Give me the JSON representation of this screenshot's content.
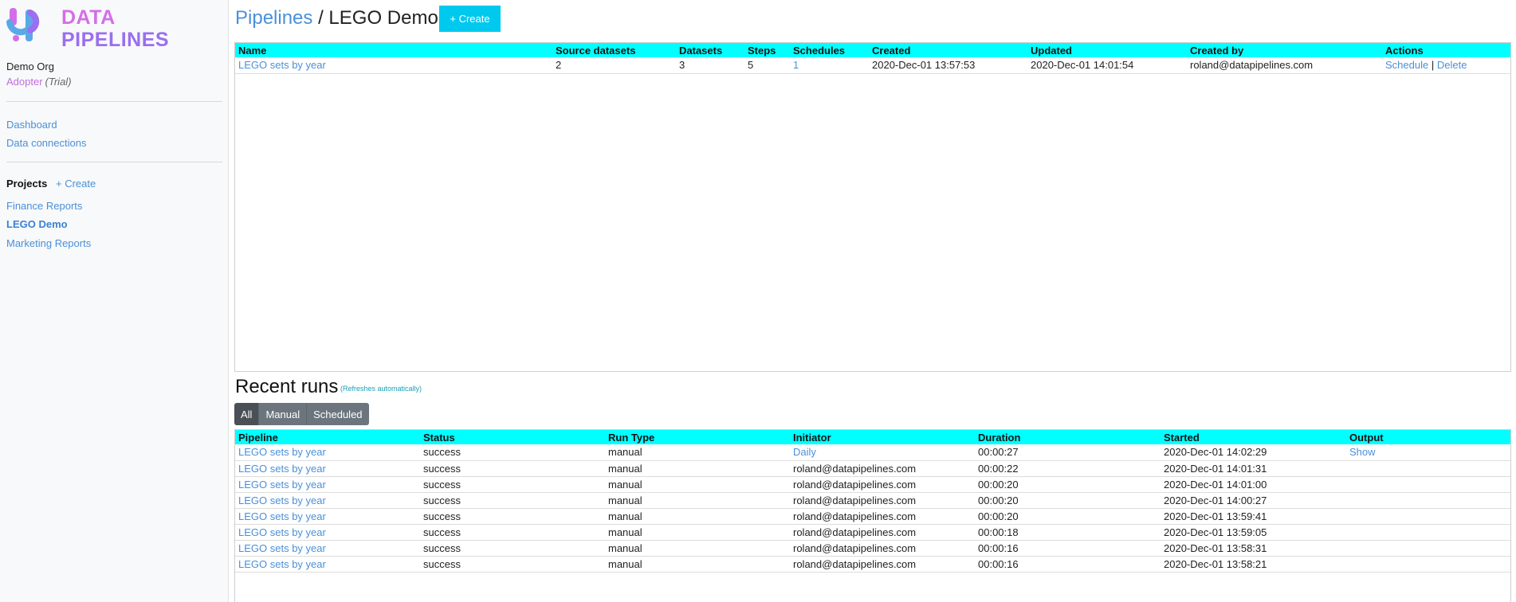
{
  "app": {
    "logo_line1": "DATA",
    "logo_line2": "PIPELINES",
    "org_name": "Demo Org",
    "plan_tier": "Adopter",
    "plan_trial": "(Trial)"
  },
  "sidebar": {
    "nav": [
      {
        "label": "Dashboard"
      },
      {
        "label": "Data connections"
      }
    ],
    "projects_heading": "Projects",
    "projects_create": "+ Create",
    "projects": [
      {
        "label": "Finance Reports",
        "active": false
      },
      {
        "label": "LEGO Demo",
        "active": true
      },
      {
        "label": "Marketing Reports",
        "active": false
      }
    ]
  },
  "header": {
    "crumb": "Pipelines",
    "separator": " / ",
    "title": "LEGO Demo",
    "create_label": "+ Create"
  },
  "pipelines_table": {
    "columns": [
      "Name",
      "Source datasets",
      "Datasets",
      "Steps",
      "Schedules",
      "Created",
      "Updated",
      "Created by",
      "Actions"
    ],
    "rows": [
      {
        "name": "LEGO sets by year",
        "source_datasets": "2",
        "datasets": "3",
        "steps": "5",
        "schedules": "1",
        "created": "2020-Dec-01 13:57:53",
        "updated": "2020-Dec-01 14:01:54",
        "created_by": "roland@datapipelines.com",
        "action_schedule": "Schedule",
        "action_sep": "|",
        "action_delete": "Delete"
      }
    ]
  },
  "runs": {
    "title": "Recent runs",
    "note": "(Refreshes automatically)",
    "filters": [
      {
        "label": "All",
        "active": true
      },
      {
        "label": "Manual",
        "active": false
      },
      {
        "label": "Scheduled",
        "active": false
      }
    ],
    "columns": [
      "Pipeline",
      "Status",
      "Run Type",
      "Initiator",
      "Duration",
      "Started",
      "Output"
    ],
    "rows": [
      {
        "pipeline": "LEGO sets by year",
        "status": "success",
        "run_type": "manual",
        "initiator": "Daily",
        "initiator_link": true,
        "duration": "00:00:27",
        "started": "2020-Dec-01 14:02:29",
        "output": "Show"
      },
      {
        "pipeline": "LEGO sets by year",
        "status": "success",
        "run_type": "manual",
        "initiator": "roland@datapipelines.com",
        "initiator_link": false,
        "duration": "00:00:22",
        "started": "2020-Dec-01 14:01:31",
        "output": ""
      },
      {
        "pipeline": "LEGO sets by year",
        "status": "success",
        "run_type": "manual",
        "initiator": "roland@datapipelines.com",
        "initiator_link": false,
        "duration": "00:00:20",
        "started": "2020-Dec-01 14:01:00",
        "output": ""
      },
      {
        "pipeline": "LEGO sets by year",
        "status": "success",
        "run_type": "manual",
        "initiator": "roland@datapipelines.com",
        "initiator_link": false,
        "duration": "00:00:20",
        "started": "2020-Dec-01 14:00:27",
        "output": ""
      },
      {
        "pipeline": "LEGO sets by year",
        "status": "success",
        "run_type": "manual",
        "initiator": "roland@datapipelines.com",
        "initiator_link": false,
        "duration": "00:00:20",
        "started": "2020-Dec-01 13:59:41",
        "output": ""
      },
      {
        "pipeline": "LEGO sets by year",
        "status": "success",
        "run_type": "manual",
        "initiator": "roland@datapipelines.com",
        "initiator_link": false,
        "duration": "00:00:18",
        "started": "2020-Dec-01 13:59:05",
        "output": ""
      },
      {
        "pipeline": "LEGO sets by year",
        "status": "success",
        "run_type": "manual",
        "initiator": "roland@datapipelines.com",
        "initiator_link": false,
        "duration": "00:00:16",
        "started": "2020-Dec-01 13:58:31",
        "output": ""
      },
      {
        "pipeline": "LEGO sets by year",
        "status": "success",
        "run_type": "manual",
        "initiator": "roland@datapipelines.com",
        "initiator_link": false,
        "duration": "00:00:16",
        "started": "2020-Dec-01 13:58:21",
        "output": ""
      }
    ]
  },
  "colors": {
    "accent": "#00c9ef",
    "header_row": "#00ffff",
    "link": "#4a90d9",
    "logo_pink": "#d46ee8",
    "logo_purple": "#9a6ff0",
    "logo_blue": "#5aa8e8"
  }
}
